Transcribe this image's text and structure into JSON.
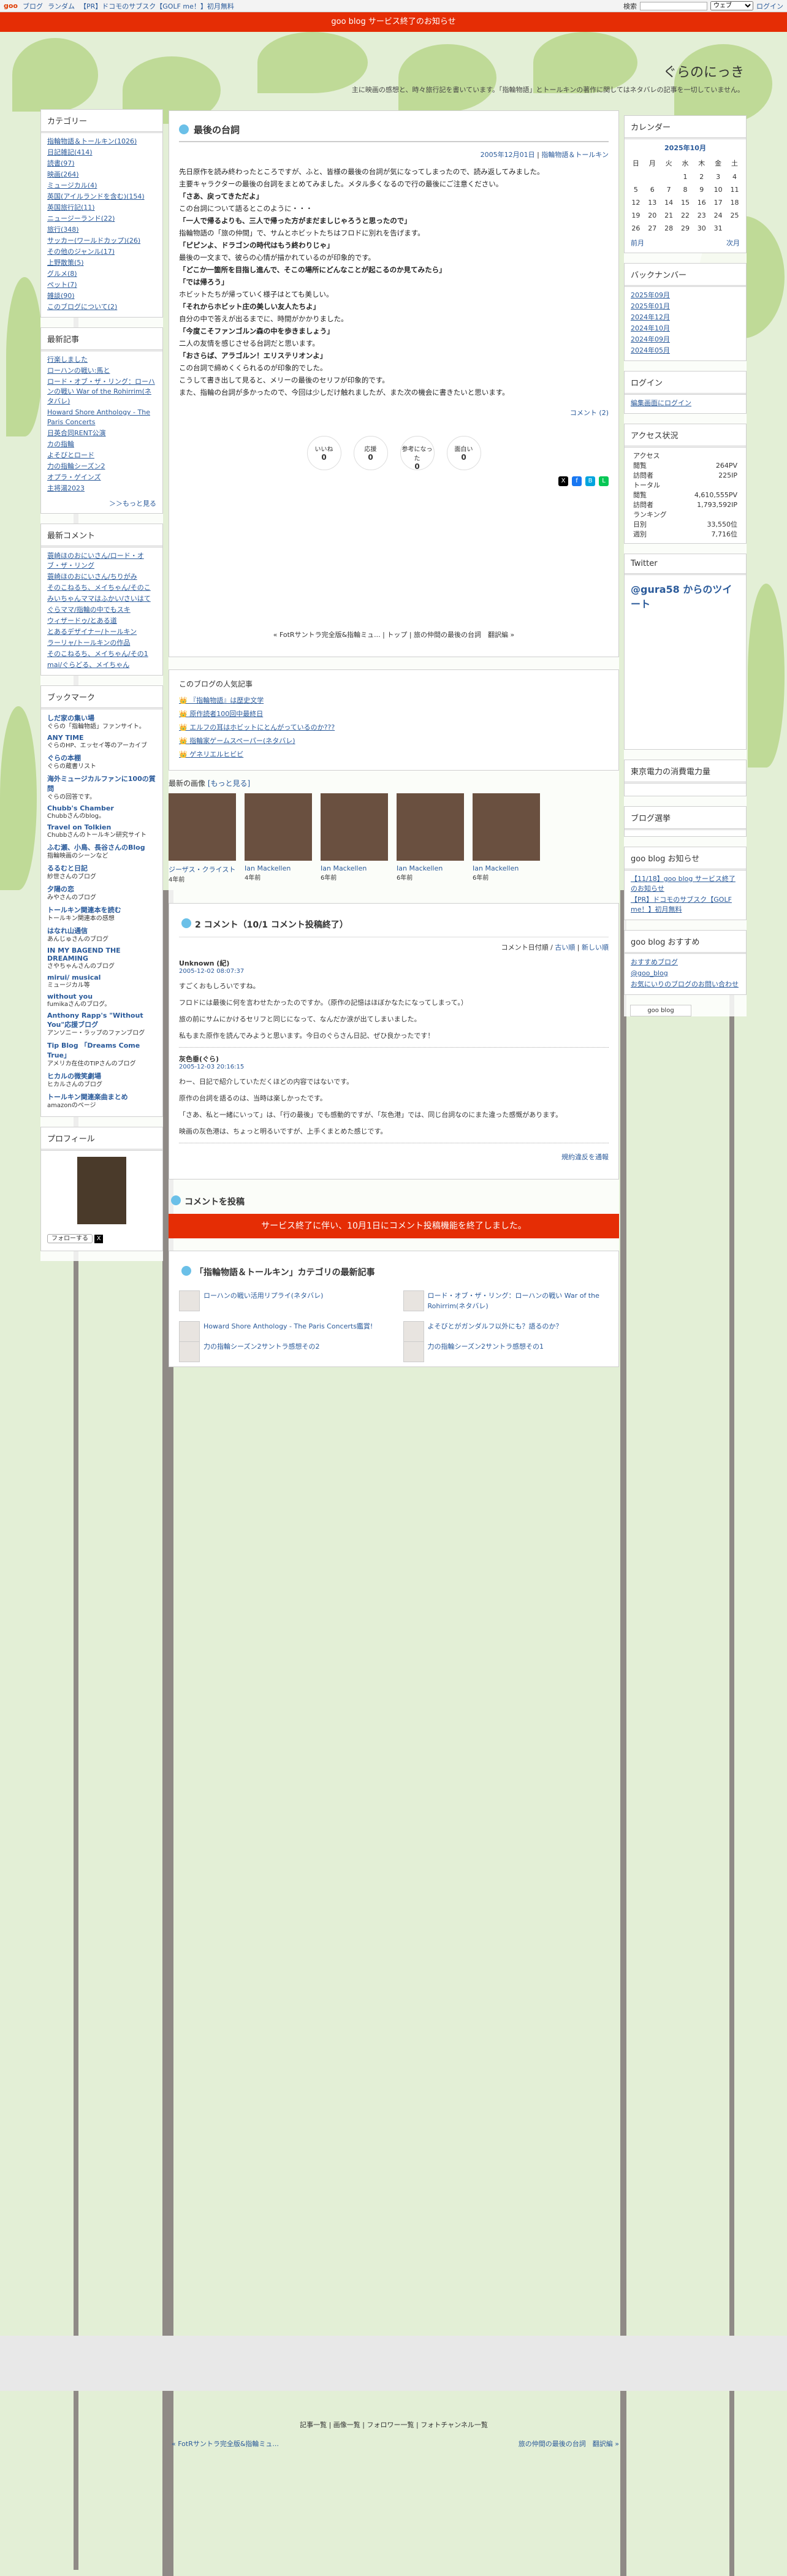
{
  "topbar": {
    "logo": "goo",
    "links": [
      "ブログ",
      "ランダム",
      "【PR】ドコモのサブスク【GOLF me！】初月無料"
    ],
    "search_label": "検索",
    "search_select": "ウェブ",
    "login": "ログイン"
  },
  "notice": "goo blog サービス終了のお知らせ",
  "blog": {
    "title": "ぐらのにっき",
    "description": "主に映画の感想と、時々旅行記を書いています。「指輪物語」とトールキンの著作に関してはネタバレの記事を一切していません。"
  },
  "left": {
    "categories_title": "カテゴリー",
    "categories": [
      "指輪物語＆トールキン(1026)",
      "日記雑記(414)",
      "読書(97)",
      "映画(264)",
      "ミュージカル(4)",
      "英国(アイルランドを含む)(154)",
      "英国旅行記(11)",
      "ニュージーランド(22)",
      "旅行(348)",
      "サッカー(ワールドカップ)(26)",
      "その他のジャンル(17)",
      "上野散策(5)",
      "グルメ(8)",
      "ペット(7)",
      "雑談(90)",
      "このブログについて(2)"
    ],
    "recent_title": "最新記事",
    "recent": [
      "行楽しました",
      "ローハンの戦い:馬と",
      "ロード・オブ・ザ・リング：ローハンの戦い War of the Rohirrim(ネタバレ)",
      "Howard Shore Anthology - The Paris Concerts",
      "日英合同RENT公演",
      "カの指輪",
      "よそびとロード",
      "力の指輪シーズン2",
      "オプラ・ゲインズ",
      "主将湯2023"
    ],
    "recent_more": "＞＞もっと見る",
    "comments_title": "最新コメント",
    "comments": [
      "蓑崎ほのおにいさん/ロード・オブ・ザ・リング",
      "蓑崎ほのおにいさん/ちりがみ",
      "そのこねるち、メイちゃん/そのこ",
      "みいちゃんママはふかい/さいはて",
      "ぐらママ/指輪の中でもスキ",
      "ウィザードゥ/とある道",
      "とあるデザイナー/トールキン",
      "ラーリャ/トールキンの作品",
      "そのこねるち、メイちゃん/その1",
      "mai/ぐらどる、メイちゃん"
    ],
    "bookmark_title": "ブックマーク",
    "bookmarks": [
      {
        "name": "しだ家の集い場",
        "desc": "ぐらの「指輪物語」ファンサイト。"
      },
      {
        "name": "ANY TIME",
        "desc": "ぐらのHP、エッセイ等のアーカイブ"
      },
      {
        "name": "ぐらの本棚",
        "desc": "ぐらの蔵書リスト"
      },
      {
        "name": "海外ミュージカルファンに100の質問",
        "desc": "ぐらの回答です。"
      },
      {
        "name": "Chubb's Chamber",
        "desc": "Chubbさんのblog。"
      },
      {
        "name": "Travel on Tolkien",
        "desc": "Chubbさんのトールキン研究サイト"
      },
      {
        "name": "ふむ瀬、小鳥、長谷さんのBlog",
        "desc": "指輪映画のシーンなど"
      },
      {
        "name": "るるむと日記",
        "desc": "紗世さんのブログ"
      },
      {
        "name": "夕陽の恋",
        "desc": "みやさんのブログ"
      },
      {
        "name": "トールキン関連本を読む",
        "desc": "トールキン関連本の感想"
      },
      {
        "name": "はなれ山通信",
        "desc": "あんじゅさんのブログ"
      },
      {
        "name": "IN MY BAGEND THE DREAMING",
        "desc": "さやちゃんさんのブログ"
      },
      {
        "name": "mirui/ musical",
        "desc": "ミュージカル等"
      },
      {
        "name": "without you",
        "desc": "fumikaさんのブログ。"
      },
      {
        "name": "Anthony Rapp's \"Without You\"応援ブログ",
        "desc": "アンソニー・ラップのファンブログ"
      },
      {
        "name": "Tip Blog 「Dreams Come True」",
        "desc": "アメリカ在住のTIPさんのブログ"
      },
      {
        "name": "ヒカルの微笑劇場",
        "desc": "ヒカルさんのブログ"
      },
      {
        "name": "トールキン関連楽曲まとめ",
        "desc": "amazonのページ"
      }
    ],
    "profile_title": "プロフィール",
    "profile_follow": "フォローする"
  },
  "right": {
    "calendar_title": "カレンダー",
    "calendar_month": "2025年10月",
    "weekdays": [
      "日",
      "月",
      "火",
      "水",
      "木",
      "金",
      "土"
    ],
    "weeks": [
      [
        "",
        "",
        "",
        "1",
        "2",
        "3",
        "4"
      ],
      [
        "5",
        "6",
        "7",
        "8",
        "9",
        "10",
        "11"
      ],
      [
        "12",
        "13",
        "14",
        "15",
        "16",
        "17",
        "18"
      ],
      [
        "19",
        "20",
        "21",
        "22",
        "23",
        "24",
        "25"
      ],
      [
        "26",
        "27",
        "28",
        "29",
        "30",
        "31",
        ""
      ]
    ],
    "prev": "前月",
    "next": "次月",
    "backnumber_title": "バックナンバー",
    "backnumbers": [
      "2025年09月",
      "2025年01月",
      "2024年12月",
      "2024年10月",
      "2024年09月",
      "2024年05月"
    ],
    "login_title": "ログイン",
    "login_link": "編集画面にログイン",
    "access_title": "アクセス状況",
    "access_label": "アクセス",
    "access_rows": [
      [
        "閲覧",
        "264PV"
      ],
      [
        "訪問者",
        "225IP"
      ]
    ],
    "total_label": "トータル",
    "total_rows": [
      [
        "閲覧",
        "4,610,555PV"
      ],
      [
        "訪問者",
        "1,793,592IP"
      ]
    ],
    "ranking_label": "ランキング",
    "ranking_rows": [
      [
        "日別",
        "33,550位"
      ],
      [
        "週別",
        "7,716位"
      ]
    ],
    "twitter_title": "Twitter",
    "twitter_link": "@gura58 からのツイート",
    "power_title": "東京電力の消費電力量",
    "blog_chosen_title": "ブログ選挙",
    "goo_info_title": "goo blog お知らせ",
    "goo_info": [
      "【11/18】goo blog サービス終了のお知らせ",
      "【PR】ドコモのサブスク【GOLF me！】初月無料"
    ],
    "goo_rec_title": "goo blog おすすめ",
    "goo_rec": [
      "おすすめブログ",
      "@goo_blog",
      "お気にいりのブログのお問い合わせ"
    ],
    "goo_badge": "goo blog"
  },
  "entry": {
    "title": "最後の台詞",
    "date": "2005年12月01日",
    "category": "指輪物語＆トールキン",
    "paragraphs": [
      {
        "t": "先日原作を読み終わったところですが、ふと、皆様の最後の台詞が気になってしまったので、読み返してみました。",
        "b": false
      },
      {
        "t": "主要キャラクターの最後の台詞をまとめてみました。メタル多くなるので行の最後にご注意ください。",
        "b": false
      },
      {
        "t": "「さあ、戻ってきただよ」",
        "b": true
      },
      {
        "t": "この台詞について語るとこのように・・・",
        "b": false
      },
      {
        "t": "「一人で帰るよりも、三人で帰った方がまだましじゃろうと思ったので」",
        "b": true
      },
      {
        "t": "指輪物語の「旅の仲間」で、サムとホビットたちはフロドに別れを告げます。",
        "b": false
      },
      {
        "t": "「ピピンよ、ドラゴンの時代はもう終わりじゃ」",
        "b": true
      },
      {
        "t": "最後の一文まで、彼らの心情が描かれているのが印象的です。",
        "b": false
      },
      {
        "t": "「どこか一箇所を目指し進んで、そこの場所にどんなことが起こるのか見てみたら」",
        "b": true
      },
      {
        "t": "「では帰ろう」",
        "b": true
      },
      {
        "t": "ホビットたちが帰っていく様子はとても美しい。",
        "b": false
      },
      {
        "t": "「それからホビット庄の美しい友人たちよ」",
        "b": true
      },
      {
        "t": "自分の中で答えが出るまでに、時間がかかりました。",
        "b": false
      },
      {
        "t": "「今度こそファンゴルン森の中を歩きましょう」",
        "b": true
      },
      {
        "t": "二人の友情を感じさせる台詞だと思います。",
        "b": false
      },
      {
        "t": "「おさらば、アラゴルン！エリステリオンよ」",
        "b": true
      },
      {
        "t": "この台詞で締めくくられるのが印象的でした。",
        "b": false
      },
      {
        "t": "こうして書き出して見ると、メリーの最後のセリフが印象的です。",
        "b": false
      },
      {
        "t": "また、指輪の台詞が多かったので、今回は少しだけ触れましたが、また次の機会に書きたいと思います。",
        "b": false
      }
    ],
    "comments_link": "コメント (2)",
    "reactions": [
      {
        "label": "いいね",
        "n": "0"
      },
      {
        "label": "応援",
        "n": "0"
      },
      {
        "label": "参考になった",
        "n": "0"
      },
      {
        "label": "面白い",
        "n": "0"
      }
    ],
    "nav": "« FotRサントラ完全版&指輪ミュ... | トップ | 旅の仲間の最後の台詞　翻訳編 »"
  },
  "popular": {
    "title": "このブログの人気記事",
    "items": [
      "『指輪物語』は歴史文学",
      "原作読者100回中最終日",
      "エルフの耳はホビットにとんがっているのか???",
      "指輪家ゲームスペーパー(ネタバレ)",
      "ゲネリエルヒビビ"
    ]
  },
  "latest_images": {
    "title": "最新の画像",
    "more": "[もっと見る]",
    "items": [
      {
        "t": "ジーザス・クライスト",
        "d": "4年前"
      },
      {
        "t": "Ian Mackellen",
        "d": "4年前"
      },
      {
        "t": "Ian Mackellen",
        "d": "6年前"
      },
      {
        "t": "Ian Mackellen",
        "d": "6年前"
      },
      {
        "t": "Ian Mackellen",
        "d": "6年前"
      }
    ]
  },
  "comments_section": {
    "title": "2 コメント（10/1 コメント投稿終了）",
    "sort": "コメント日付順",
    "sort_old": "古い順",
    "sort_new": "新しい順",
    "list": [
      {
        "name": "Unknown (紀)",
        "date": "2005-12-02 08:07:37",
        "lines": [
          "すごくおもしろいですね。",
          "フロドには最後に何を言わせたかったのですか。（原作の記憶はほぼかなたになってしまって。）",
          "旅の前にサムにかけるセリフと同じになって、なんだか涙が出てしまいました。",
          "私もまた原作を読んでみようと思います。今日のぐらさん日記、ぜひ良かったです！"
        ]
      },
      {
        "name": "灰色垂(ぐら)",
        "date": "2005-12-03 20:16:15",
        "lines": [
          "わー、日記で紹介していただくほどの内容ではないです。",
          "原作の台詞を語るのは、当時は楽しかったです。",
          "「さあ、私と一緒にいって」は、「行の最後」でも感動的ですが、「灰色港」では、同じ台詞なのにまた違った感慨があります。",
          "映画の灰色港は、ちょっと明るいですが、上手くまとめた感じです。"
        ]
      }
    ],
    "bottom_link": "規約違反を通報"
  },
  "post_comment": {
    "title": "コメントを投稿",
    "closed": "サービス終了に伴い、10月1日にコメント投稿機能を終了しました。"
  },
  "category_latest": {
    "title": "「指輪物語＆トールキン」カテゴリの最新記事",
    "items": [
      "ローハンの戦い活用リプライ(ネタバレ)",
      "ロード・オブ・ザ・リング：ローハンの戦い War of the Rohirrim(ネタバレ)",
      "Howard Shore Anthology - The Paris Concerts鑑賞!",
      "よそびとがガンダルフ以外にも？語るのか？",
      "力の指輪シーズン2サントラ感想その2",
      "力の指輪シーズン2サントラ感想その1"
    ]
  },
  "footer": {
    "links": "記事一覧 | 画像一覧 | フォロワー一覧 | フォトチャンネル一覧",
    "prev": "« FotRサントラ完全版&指輪ミュ...",
    "next": "旅の仲間の最後の台詞　翻訳編 »"
  },
  "colors": {
    "accent": "#e52d05",
    "link": "#2a5a9a",
    "leaf": "#a7cb6c"
  }
}
